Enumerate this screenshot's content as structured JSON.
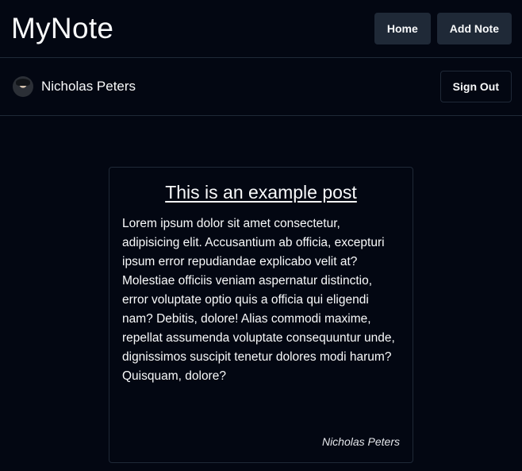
{
  "header": {
    "logo": "MyNote",
    "nav": {
      "home_label": "Home",
      "add_note_label": "Add Note"
    }
  },
  "user_bar": {
    "user_name": "Nicholas Peters",
    "sign_out_label": "Sign Out"
  },
  "note": {
    "title": "This is an example post",
    "body": "Lorem ipsum dolor sit amet consectetur, adipisicing elit. Accusantium ab officia, excepturi ipsum error repudiandae explicabo velit at? Molestiae officiis veniam aspernatur distinctio, error voluptate optio quis a officia qui eligendi nam? Debitis, dolore! Alias commodi maxime, repellat assumenda voluptate consequuntur unde, dignissimos suscipit tenetur dolores modi harum? Quisquam, dolore?",
    "author": "Nicholas Peters"
  }
}
